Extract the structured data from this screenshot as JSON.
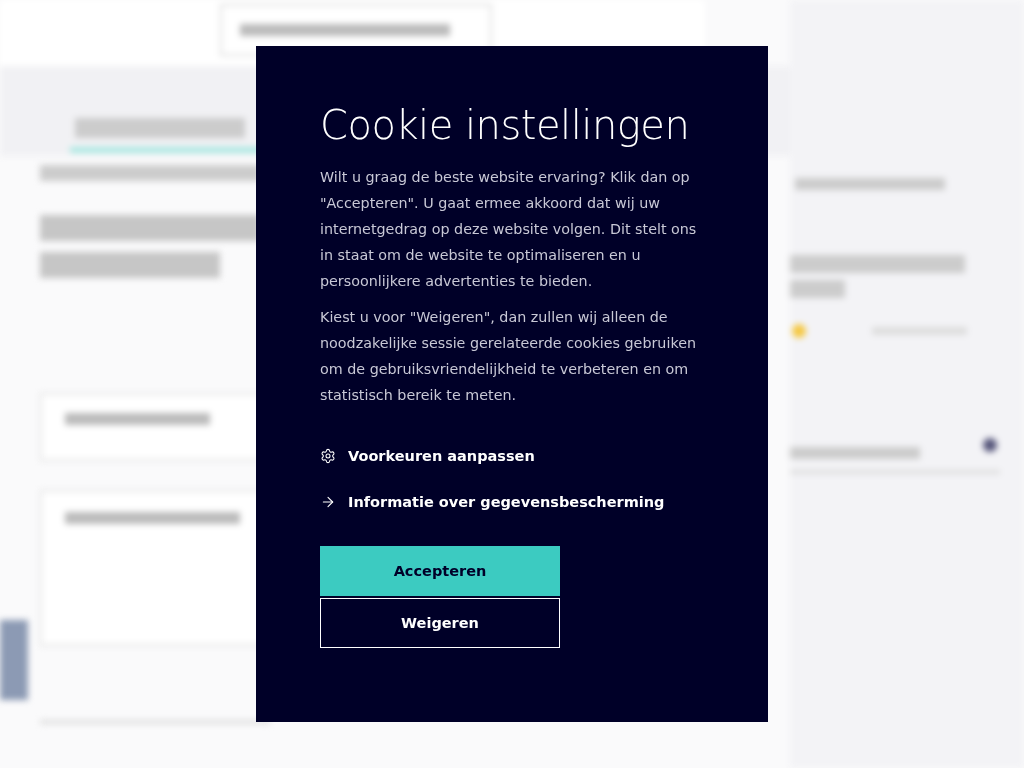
{
  "dialog": {
    "title": "Cookie instellingen",
    "paragraphs": [
      "Wilt u graag de beste website ervaring? Klik dan op \"Accepteren\". U gaat ermee akkoord dat wij uw internetgedrag op deze website volgen. Dit stelt ons in staat om de website te optimaliseren en u persoonlijkere advertenties te bieden.",
      "Kiest u voor \"Weigeren\", dan zullen wij alleen de noodzakelijke sessie gerelateerde cookies gebruiken om de gebruiksvriendelijkheid te verbeteren en om statistisch bereik te meten."
    ],
    "links": [
      {
        "kind": "settings",
        "label": "Voorkeuren aanpassen"
      },
      {
        "kind": "arrow",
        "label": "Informatie over gegevensbescherming"
      }
    ],
    "buttons": [
      {
        "kind": "primary",
        "label": "Accepteren"
      },
      {
        "kind": "secondary",
        "label": "Weigeren"
      }
    ]
  }
}
